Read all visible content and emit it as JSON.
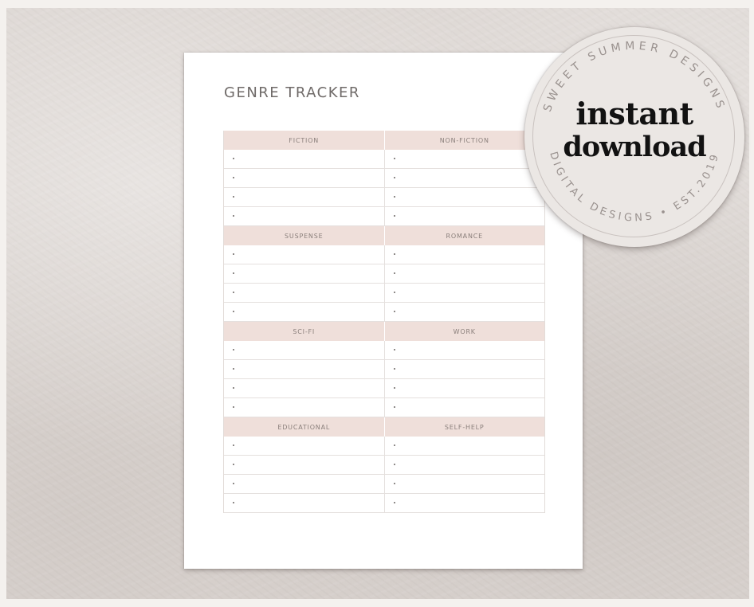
{
  "document": {
    "title": "GENRE TRACKER",
    "sections": [
      {
        "headers": [
          "FICTION",
          "NON-FICTION"
        ],
        "bullet": "•",
        "rows": 4
      },
      {
        "headers": [
          "SUSPENSE",
          "ROMANCE"
        ],
        "bullet": "•",
        "rows": 4
      },
      {
        "headers": [
          "SCI-FI",
          "WORK"
        ],
        "bullet": "•",
        "rows": 4
      },
      {
        "headers": [
          "EDUCATIONAL",
          "SELF-HELP"
        ],
        "bullet": "•",
        "rows": 4
      }
    ]
  },
  "badge": {
    "line1": "instant",
    "line2": "download",
    "arc_top": "SWEET SUMMER DESIGNS",
    "arc_bottom": "DIGITAL DESIGNS • EST.2019"
  },
  "colors": {
    "header_fill": "#efdfda",
    "badge_fill": "#ebe7e4",
    "title_text": "#6f6a68"
  }
}
